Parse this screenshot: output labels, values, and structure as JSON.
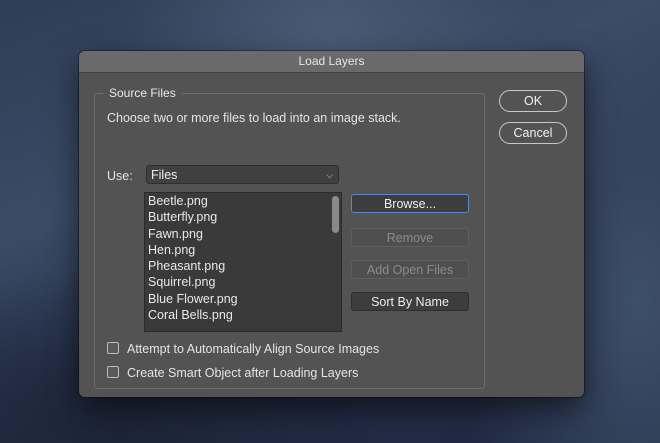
{
  "dialog": {
    "title": "Load Layers"
  },
  "source_files": {
    "group_label": "Source Files",
    "description": "Choose two or more files to load into an image stack.",
    "use_label": "Use:",
    "use_selected": "Files",
    "files": [
      "Beetle.png",
      "Butterfly.png",
      "Fawn.png",
      "Hen.png",
      "Pheasant.png",
      "Squirrel.png",
      "Blue Flower.png",
      "Coral Bells.png"
    ],
    "buttons": {
      "browse": "Browse...",
      "remove": "Remove",
      "add_open_files": "Add Open Files",
      "sort_by_name": "Sort By Name"
    }
  },
  "actions": {
    "ok": "OK",
    "cancel": "Cancel"
  },
  "options": {
    "align_label": "Attempt to Automatically Align Source Images",
    "smart_object_label": "Create Smart Object after Loading Layers"
  }
}
